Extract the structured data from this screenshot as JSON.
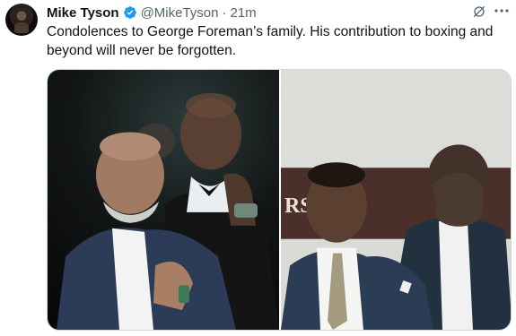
{
  "author": {
    "name": "Mike Tyson",
    "handle": "@MikeTyson",
    "separator": "·",
    "time": "21m"
  },
  "tweet": {
    "text": "Condolences to George Foreman’s family. His contribution to boxing and beyond will never be forgotten."
  },
  "icons": {
    "verified": "verified-badge-icon",
    "grok": "grok-icon",
    "more": "more-options-icon"
  },
  "colors": {
    "verified_blue": "#1d9bf0",
    "secondary_text": "#536471",
    "primary_text": "#0f1419"
  },
  "media": {
    "count": 2,
    "left_banner_text": "",
    "right_banner_text": "RS  ΛCΛ"
  }
}
